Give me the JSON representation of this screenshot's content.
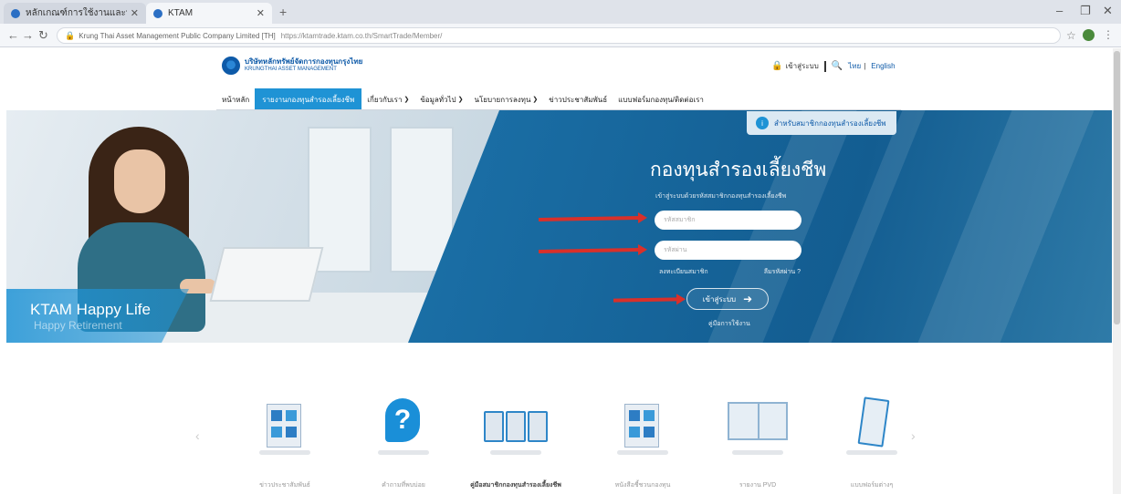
{
  "browser": {
    "tabs": [
      {
        "label": "หลักเกณฑ์การใช้งานและนโยบาย",
        "active": false
      },
      {
        "label": "KTAM",
        "active": true
      }
    ],
    "address": {
      "cert": "Krung Thai Asset Management Public Company Limited [TH]",
      "url": "https://ktamtrade.ktam.co.th/SmartTrade/Member/"
    }
  },
  "header": {
    "logo_th": "บริษัทหลักทรัพย์จัดการกองทุนกรุงไทย",
    "logo_en": "KRUNGTHAI ASSET MANAGEMENT",
    "util": {
      "login": "เข้าสู่ระบบ",
      "lang_th": "ไทย",
      "lang_en": "English"
    }
  },
  "nav": {
    "items": [
      {
        "label": "หน้าหลัก",
        "active": false,
        "dropdown": false
      },
      {
        "label": "รายงานกองทุนสำรองเลี้ยงชีพ",
        "active": true,
        "dropdown": false
      },
      {
        "label": "เกี่ยวกับเรา",
        "active": false,
        "dropdown": true
      },
      {
        "label": "ข้อมูลทั่วไป",
        "active": false,
        "dropdown": true
      },
      {
        "label": "นโยบายการลงทุน",
        "active": false,
        "dropdown": true
      },
      {
        "label": "ข่าวประชาสัมพันธ์",
        "active": false,
        "dropdown": false
      },
      {
        "label": "แบบฟอร์มกองทุน/ติดต่อเรา",
        "active": false,
        "dropdown": false
      }
    ]
  },
  "hero": {
    "tagline": "KTAM Happy Life",
    "subtagline": "Happy Retirement",
    "tab_pill": "สำหรับสมาชิกกองทุนสำรองเลี้ยงชีพ",
    "tab_pill_icon": "info-icon"
  },
  "login": {
    "title": "กองทุนสำรองเลี้ยงชีพ",
    "description": "เข้าสู่ระบบด้วยรหัสสมาชิกกองทุนสำรองเลี้ยงชีพ",
    "username_placeholder": "รหัสสมาชิก",
    "password_placeholder": "รหัสผ่าน",
    "register": "ลงทะเบียนสมาชิก",
    "forgot": "ลืมรหัสผ่าน ?",
    "submit": "เข้าสู่ระบบ",
    "manual": "คู่มือการใช้งาน"
  },
  "features": [
    {
      "label": "ข่าวประชาสัมพันธ์",
      "icon": "newsletter-icon",
      "bold": false
    },
    {
      "label": "คำถามที่พบบ่อย",
      "icon": "question-icon",
      "bold": false
    },
    {
      "label": "คู่มือสมาชิกกองทุนสำรองเลี้ยงชีพ",
      "icon": "books-icon",
      "bold": true
    },
    {
      "label": "หนังสือชี้ชวนกองทุน",
      "icon": "newsletter-icon",
      "bold": false
    },
    {
      "label": "รายงาน PVD",
      "icon": "open-book-icon",
      "bold": false
    },
    {
      "label": "แบบฟอร์มต่างๆ",
      "icon": "clipboard-icon",
      "bold": false
    }
  ],
  "colors": {
    "brand": "#0e5aa8",
    "accent": "#1f93d5",
    "hero_blue": "#1a6ea5",
    "annotation": "#d9302a"
  }
}
